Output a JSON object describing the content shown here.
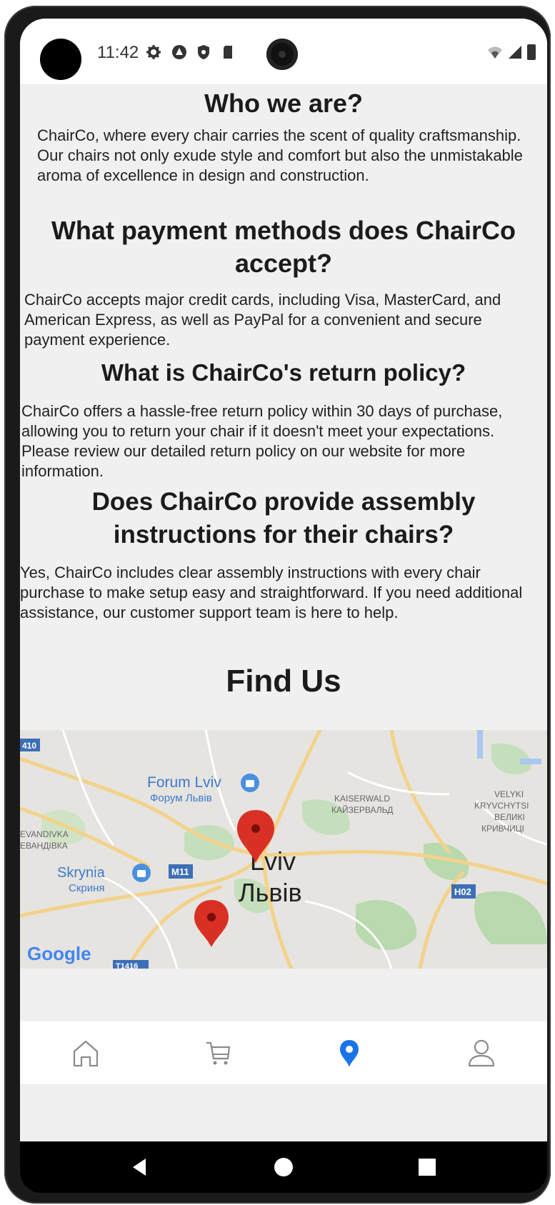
{
  "status_bar": {
    "time": "11:42",
    "icons": [
      "gear-icon",
      "assistant-icon",
      "shield-icon",
      "sd-card-icon"
    ],
    "right_icons": [
      "wifi-icon",
      "signal-icon",
      "battery-icon"
    ]
  },
  "faq": [
    {
      "question": "Who we are?",
      "answer": "ChairCo, where every chair carries the scent of quality craftsmanship. Our chairs not only exude style and comfort but also the unmistakable aroma of excellence in design and construction."
    },
    {
      "question": "What payment methods does ChairCo accept?",
      "answer": "ChairCo accepts major credit cards, including Visa, MasterCard, and American Express, as well as PayPal for a convenient and secure payment experience."
    },
    {
      "question": "What is ChairCo's return policy?",
      "answer": "ChairCo offers a hassle-free return policy within 30 days of purchase, allowing you to return your chair if it doesn't meet your expectations. Please review our detailed return policy on our website for more information."
    },
    {
      "question": "Does ChairCo provide assembly instructions for their chairs?",
      "answer": " Yes, ChairCo includes clear assembly instructions with every chair purchase to make setup easy and straightforward. If you need additional assistance, our customer support team is here to help."
    }
  ],
  "find_us": {
    "title": "Find Us"
  },
  "map": {
    "labels": {
      "forum": "Forum Lviv",
      "forum_ua": "Форум Львів",
      "skrynia": "Skrynia",
      "skrynia_ua": "Скриня",
      "kaiserwald": "KAISERWALD",
      "kaiserwald_ua": "КАЙЗЕРВАЛЬД",
      "velyki1": "VELYKI",
      "velyki2": "KRYVCHYTSI",
      "velyki3": "ВЕЛИКІ",
      "velyki4": "КРИВЧИЦІ",
      "levandivka1": "EVANDIVKA",
      "levandivka2": "ЕВАНДІВКА",
      "city": "Lviv",
      "city_ua": "Львів",
      "road_m11": "M11",
      "road_h02": "H02",
      "road_410": "410",
      "road_t1416": "T1416",
      "google": "Google"
    }
  },
  "tabs": [
    {
      "name": "home",
      "icon": "home-icon",
      "active": false
    },
    {
      "name": "cart",
      "icon": "cart-icon",
      "active": false
    },
    {
      "name": "location",
      "icon": "location-pin-icon",
      "active": true
    },
    {
      "name": "profile",
      "icon": "user-icon",
      "active": false
    }
  ],
  "colors": {
    "accent": "#1a73e8",
    "pin": "#d93025",
    "background": "#f0f0f0"
  }
}
